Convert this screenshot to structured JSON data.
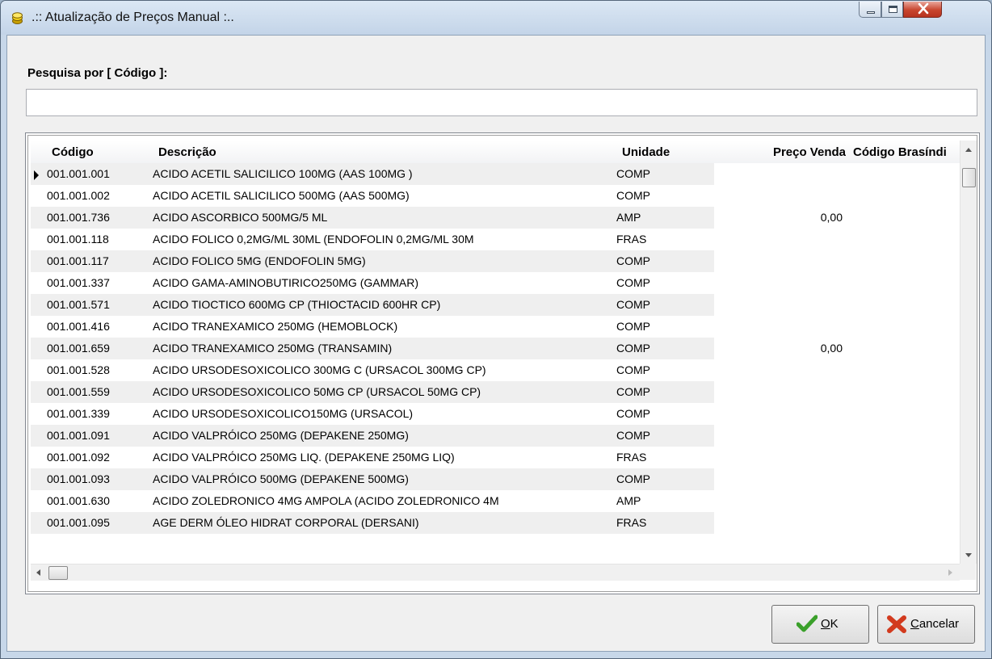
{
  "window": {
    "title": ".:: Atualização de Preços Manual :..",
    "icon": "coins-icon",
    "controls": [
      "minimize-icon",
      "maximize-icon",
      "close-icon"
    ]
  },
  "search": {
    "label": "Pesquisa por [ Código ]:",
    "value": "",
    "placeholder": ""
  },
  "grid": {
    "columns": [
      "Código",
      "Descrição",
      "Unidade",
      "Preço Venda",
      "Código Brasíndi"
    ],
    "selected_row": 0,
    "rows": [
      {
        "codigo": "001.001.001",
        "descricao": "ACIDO ACETIL SALICILICO 100MG (AAS 100MG )",
        "unidade": "COMP",
        "preco": "",
        "brasindice": ""
      },
      {
        "codigo": "001.001.002",
        "descricao": "ACIDO ACETIL SALICILICO 500MG (AAS 500MG)",
        "unidade": "COMP",
        "preco": "",
        "brasindice": ""
      },
      {
        "codigo": "001.001.736",
        "descricao": "ACIDO ASCORBICO 500MG/5 ML",
        "unidade": "AMP",
        "preco": "0,00",
        "brasindice": ""
      },
      {
        "codigo": "001.001.118",
        "descricao": "ACIDO FOLICO 0,2MG/ML 30ML (ENDOFOLIN 0,2MG/ML 30M",
        "unidade": "FRAS",
        "preco": "",
        "brasindice": ""
      },
      {
        "codigo": "001.001.117",
        "descricao": "ACIDO FOLICO 5MG (ENDOFOLIN 5MG)",
        "unidade": "COMP",
        "preco": "",
        "brasindice": ""
      },
      {
        "codigo": "001.001.337",
        "descricao": "ACIDO GAMA-AMINOBUTIRICO250MG (GAMMAR)",
        "unidade": "COMP",
        "preco": "",
        "brasindice": ""
      },
      {
        "codigo": "001.001.571",
        "descricao": "ACIDO TIOCTICO 600MG  CP (THIOCTACID 600HR CP)",
        "unidade": "COMP",
        "preco": "",
        "brasindice": ""
      },
      {
        "codigo": "001.001.416",
        "descricao": "ACIDO TRANEXAMICO 250MG (HEMOBLOCK)",
        "unidade": "COMP",
        "preco": "",
        "brasindice": ""
      },
      {
        "codigo": "001.001.659",
        "descricao": "ACIDO TRANEXAMICO 250MG (TRANSAMIN)",
        "unidade": "COMP",
        "preco": "0,00",
        "brasindice": ""
      },
      {
        "codigo": "001.001.528",
        "descricao": "ACIDO URSODESOXICOLICO 300MG C (URSACOL 300MG CP)",
        "unidade": "COMP",
        "preco": "",
        "brasindice": ""
      },
      {
        "codigo": "001.001.559",
        "descricao": "ACIDO URSODESOXICOLICO 50MG CP (URSACOL 50MG CP)",
        "unidade": "COMP",
        "preco": "",
        "brasindice": ""
      },
      {
        "codigo": "001.001.339",
        "descricao": "ACIDO URSODESOXICOLICO150MG (URSACOL)",
        "unidade": "COMP",
        "preco": "",
        "brasindice": ""
      },
      {
        "codigo": "001.001.091",
        "descricao": "ACIDO VALPRÓICO 250MG (DEPAKENE 250MG)",
        "unidade": "COMP",
        "preco": "",
        "brasindice": ""
      },
      {
        "codigo": "001.001.092",
        "descricao": "ACIDO VALPRÓICO 250MG LIQ. (DEPAKENE 250MG LIQ)",
        "unidade": "FRAS",
        "preco": "",
        "brasindice": ""
      },
      {
        "codigo": "001.001.093",
        "descricao": "ACIDO VALPRÓICO 500MG (DEPAKENE 500MG)",
        "unidade": "COMP",
        "preco": "",
        "brasindice": ""
      },
      {
        "codigo": "001.001.630",
        "descricao": "ACIDO ZOLEDRONICO 4MG AMPOLA (ACIDO ZOLEDRONICO 4M",
        "unidade": "AMP",
        "preco": "",
        "brasindice": ""
      },
      {
        "codigo": "001.001.095",
        "descricao": "AGE DERM  ÓLEO HIDRAT CORPORAL (DERSANI)",
        "unidade": "FRAS",
        "preco": "",
        "brasindice": ""
      }
    ]
  },
  "buttons": {
    "ok": {
      "label": "OK",
      "icon": "check-icon",
      "color": "#3aa02a"
    },
    "cancel": {
      "label": "Cancelar",
      "icon": "x-icon",
      "color": "#d23a1e"
    }
  }
}
